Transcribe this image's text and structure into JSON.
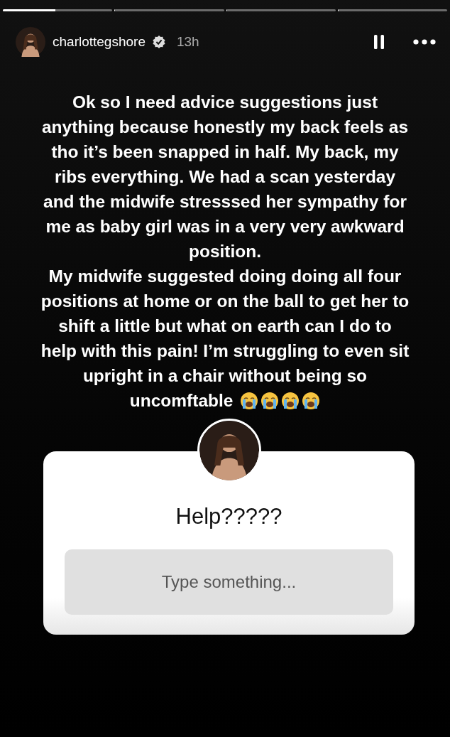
{
  "progress": [
    {
      "level": 0.48
    },
    {
      "level": 0
    },
    {
      "level": 0
    },
    {
      "level": 0
    }
  ],
  "header": {
    "username": "charlottegshore",
    "verified": true,
    "time": "13h"
  },
  "story_text": [
    "Ok so I need advice suggestions just anything because honestly my back feels as tho it’s been snapped in half. My back, my ribs everything. We had a scan yesterday and the midwife stresssed her sympathy for me as baby girl was in a very very awkward position.",
    "My midwife suggested doing doing all four positions at home or on the ball to get her to shift a little but what on earth can I do to help with this pain! I’m struggling to even sit upright in a chair without being so uncomftable"
  ],
  "emojis": [
    {
      "kind": "crying"
    },
    {
      "kind": "crying"
    },
    {
      "kind": "crying"
    },
    {
      "kind": "crying"
    }
  ],
  "question_sticker": {
    "question": "Help?????",
    "placeholder": "Type something..."
  }
}
